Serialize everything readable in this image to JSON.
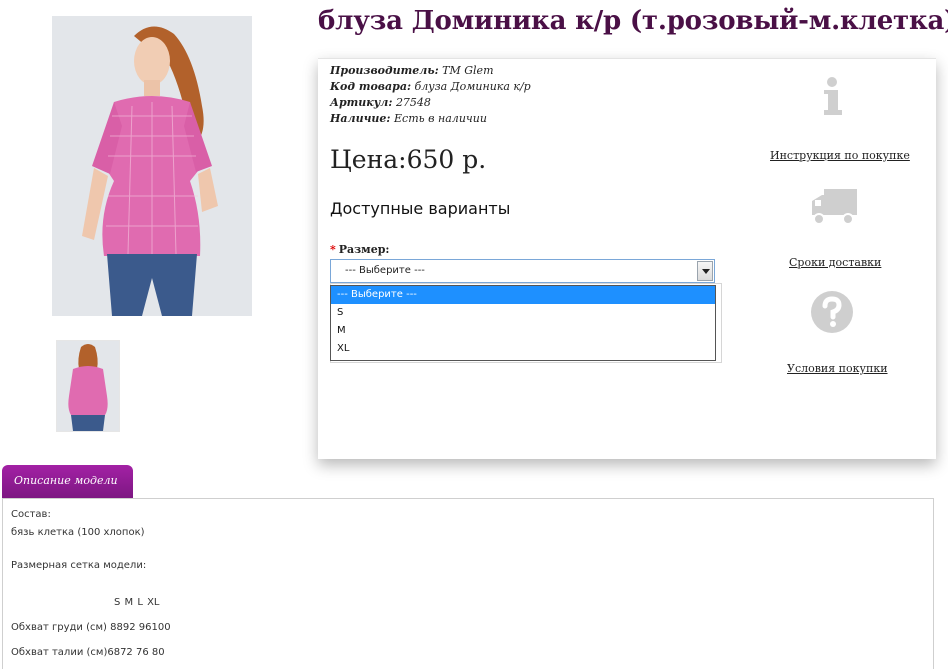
{
  "product": {
    "title": "блуза Доминика к/р (т.розовый-м.клетка)",
    "main_image_alt": "model in pink checked blouse",
    "meta": [
      {
        "key": "Производитель:",
        "value": "TM Glem"
      },
      {
        "key": "Код товара:",
        "value": "блуза Доминика к/р"
      },
      {
        "key": "Артикул:",
        "value": "27548"
      },
      {
        "key": "Наличие:",
        "value": "Есть в наличии"
      }
    ],
    "price": "Цена:650 р.",
    "variants_heading": "Доступные варианты",
    "size_label": "Размер:",
    "size_required_mark": "*",
    "size_select_value": "--- Выберите ---",
    "size_options": [
      "--- Выберите ---",
      "S",
      "M",
      "XL"
    ]
  },
  "side_links": [
    {
      "label": "Инструкция по покупке",
      "icon": "info-icon"
    },
    {
      "label": "Сроки доставки",
      "icon": "truck-icon"
    },
    {
      "label": "Условия покупки",
      "icon": "question-icon"
    }
  ],
  "tabs": {
    "description_tab": "Описание модели"
  },
  "description": {
    "composition_label": "Состав:",
    "composition_value": "бязь клетка (100 хлопок)",
    "size_grid_label": "Размерная сетка модели:",
    "size_grid_header": "S  M  L  XL",
    "rows": [
      "Обхват груди (см) 8892 96100",
      "Обхват талии (см)6872 76 80"
    ]
  },
  "colors": {
    "title": "#4a1046",
    "tab": "#8e1c92",
    "selected_option": "#1e90ff",
    "icon_gray": "#cfcfcf"
  }
}
